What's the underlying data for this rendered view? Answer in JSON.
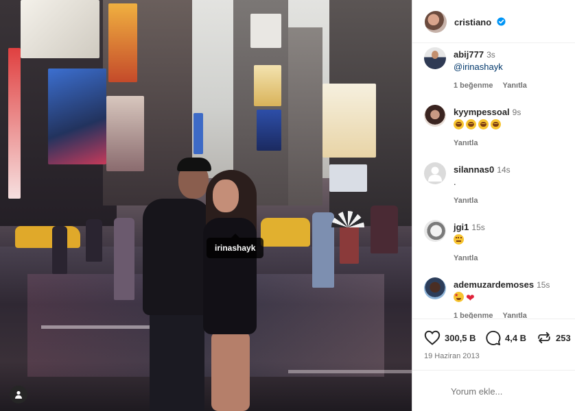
{
  "photo": {
    "tag_label": "irinashayk",
    "tag_button_icon": "person-icon"
  },
  "header": {
    "username": "cristiano",
    "verified_icon": "verified-badge-icon"
  },
  "comments": [
    {
      "username": "abij777",
      "time": "3s",
      "text": "@irinashayk",
      "likes": "1 beğenme",
      "reply": "Yanıtla"
    },
    {
      "username": "kyympessoal",
      "time": "9s",
      "emojis": [
        "lol",
        "lol",
        "lol",
        "lol"
      ],
      "reply": "Yanıtla"
    },
    {
      "username": "silannas0",
      "time": "14s",
      "text": ".",
      "reply": "Yanıtla"
    },
    {
      "username": "jgi1",
      "time": "15s",
      "emojis": [
        "think"
      ],
      "reply": "Yanıtla"
    },
    {
      "username": "ademuzardemoses",
      "time": "15s",
      "emojis": [
        "star",
        "heart"
      ],
      "likes": "1 beğenme",
      "reply": "Yanıtla"
    }
  ],
  "actions": {
    "likes": "300,5 B",
    "comments": "4,4 B",
    "reposts": "253",
    "date": "19 Haziran 2013"
  },
  "add_comment": {
    "placeholder": "Yorum ekle..."
  },
  "colors": {
    "verified": "#0095f6",
    "link": "#00376b",
    "muted": "#737373"
  }
}
